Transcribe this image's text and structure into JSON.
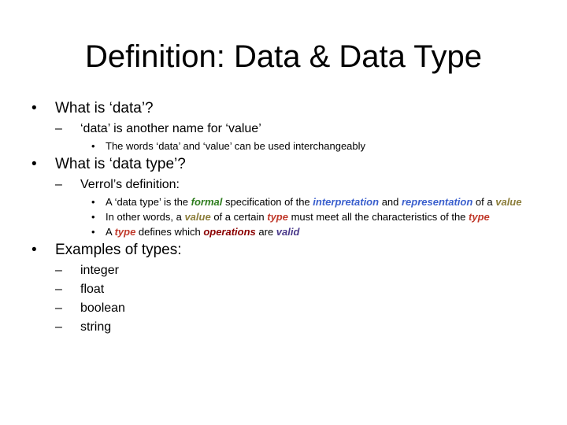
{
  "slide": {
    "title": "Definition: Data & Data Type",
    "bullet_l1": "•",
    "bullet_l2": "–",
    "bullet_l3": "•",
    "items": {
      "what_is_data": "What is  ‘data’?",
      "data_another_name": "‘data’ is another name for ‘value’",
      "interchangeably": "The words ‘data’ and ‘value’ can be used interchangeably",
      "what_is_data_type": "What is ‘data type’?",
      "verrols_definition": "Verrol’s definition:",
      "def_line": {
        "p1": "A ‘data type’ is the ",
        "formal": "formal",
        "p2": " specification of the ",
        "interpretation": "interpretation",
        "p3": " and ",
        "representation": "representation",
        "p4": " of a ",
        "value": "value"
      },
      "other_words": {
        "p1": "In other words, a ",
        "value": "value",
        "p2": " of a certain ",
        "type1": "type",
        "p3": " must meet all the characteristics of the ",
        "type2": "type"
      },
      "defines": {
        "p1": "A ",
        "type": "type",
        "p2": " defines which ",
        "operations": "operations",
        "p3": " are ",
        "valid": "valid"
      },
      "examples_heading": "Examples of types:",
      "examples": [
        "integer",
        "float",
        "boolean",
        "string"
      ]
    },
    "colors": {
      "formal": "#2e7d1e",
      "interpretation": "#3a5fcd",
      "value": "#8b7d3a",
      "type": "#c0392b",
      "operations": "#8b0000",
      "valid": "#4b3b8c"
    }
  }
}
